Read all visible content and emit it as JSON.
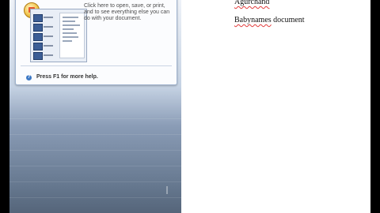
{
  "callout": {
    "description": "Click here to open, save, or print, and to see everything else you can do with your document.",
    "help_text": "Press F1 for more help."
  },
  "document": {
    "lines": [
      {
        "misspelled": "Agurchand",
        "rest": ""
      },
      {
        "misspelled": "Babynames",
        "rest": " document"
      }
    ]
  },
  "colors": {
    "background": "#000000",
    "page": "#ffffff",
    "spellcheck": "#e23b3b"
  },
  "icons": {
    "office_button": "office-button-icon",
    "help": "help-icon"
  }
}
